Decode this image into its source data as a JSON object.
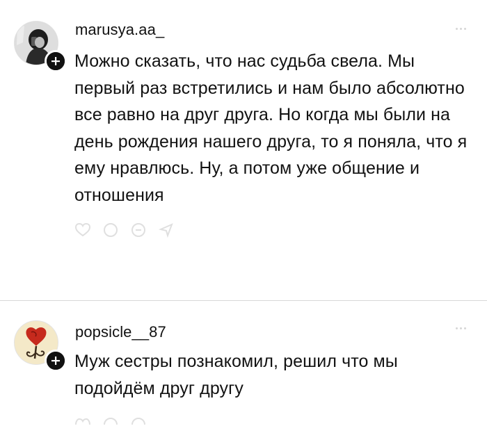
{
  "comments": [
    {
      "username": "marusya.aa_",
      "text": "Можно сказать, что нас судьба свела. Мы первый раз встретились и нам было абсолютно все равно на друг друга. Но когда мы были на день рождения нашего друга, то я поняла, что я ему нравлюсь. Ну, а потом уже общение и отношения",
      "avatar_icon": "profile-photo",
      "badge_icon": "plus-icon"
    },
    {
      "username": "popsicle__87",
      "text": "Муж сестры познакомил, решил что мы подойдём друг другу",
      "avatar_icon": "rose-heart-illustration",
      "badge_icon": "plus-icon"
    }
  ],
  "colors": {
    "text": "#111111",
    "badge": "#111111",
    "divider": "#d8d8d8",
    "faded_icons": "#bdbdbd"
  }
}
